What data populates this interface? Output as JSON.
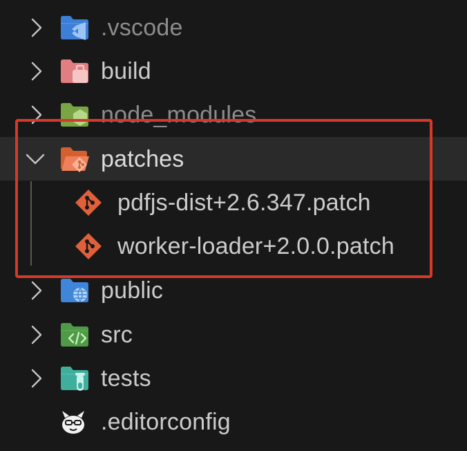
{
  "explorer": {
    "items": [
      {
        "label": ".vscode",
        "icon": "vscode-folder-icon",
        "expanded": false
      },
      {
        "label": "build",
        "icon": "build-folder-icon",
        "expanded": false
      },
      {
        "label": "node_modules",
        "icon": "node-folder-icon",
        "expanded": false
      },
      {
        "label": "patches",
        "icon": "git-folder-open-icon",
        "expanded": true,
        "selected": true
      },
      {
        "label": "pdfjs-dist+2.6.347.patch",
        "icon": "git-patch-icon",
        "child": true
      },
      {
        "label": "worker-loader+2.0.0.patch",
        "icon": "git-patch-icon",
        "child": true
      },
      {
        "label": "public",
        "icon": "public-folder-icon",
        "expanded": false
      },
      {
        "label": "src",
        "icon": "src-folder-icon",
        "expanded": false
      },
      {
        "label": "tests",
        "icon": "tests-folder-icon",
        "expanded": false
      },
      {
        "label": ".editorconfig",
        "icon": "editorconfig-icon",
        "file": true
      }
    ]
  },
  "colors": {
    "background": "#181818",
    "selected_row": "#2a2a2a",
    "label": "#cccccc",
    "annotation_border": "#d43a2a",
    "git_orange": "#e0603a"
  }
}
